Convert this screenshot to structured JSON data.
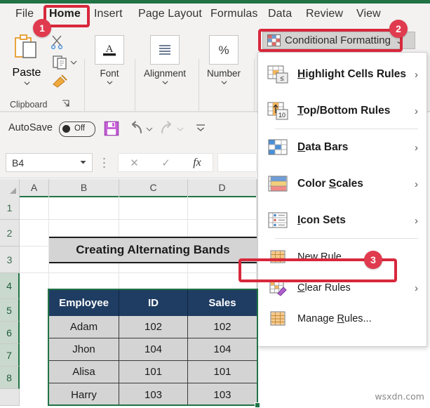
{
  "window": {
    "accent_green": "#217346",
    "annotation_red": "#d8283c"
  },
  "ribbon_tabs": [
    {
      "label": "File",
      "selected": false
    },
    {
      "label": "Home",
      "selected": true
    },
    {
      "label": "Insert",
      "selected": false
    },
    {
      "label": "Page Layout",
      "selected": false
    },
    {
      "label": "Formulas",
      "selected": false
    },
    {
      "label": "Data",
      "selected": false
    },
    {
      "label": "Review",
      "selected": false
    },
    {
      "label": "View",
      "selected": false
    }
  ],
  "ribbon": {
    "clipboard": {
      "paste_label": "Paste",
      "group_label": "Clipboard"
    },
    "groups": [
      {
        "label": "Font",
        "icon": "font-a-icon"
      },
      {
        "label": "Alignment",
        "icon": "alignment-lines-icon"
      },
      {
        "label": "Number",
        "icon": "percent-icon"
      }
    ],
    "conditional_formatting": {
      "label": "Conditional Formatting",
      "dropdown_caret": "⌄"
    }
  },
  "menu": {
    "items": [
      {
        "label": "Highlight Cells Rules",
        "accel": "H",
        "icon": "highlight-cells-icon",
        "submenu": true,
        "arrow": "›"
      },
      {
        "label": "Top/Bottom Rules",
        "accel": "T",
        "icon": "top-bottom-rules-icon",
        "submenu": true,
        "arrow": "›"
      },
      {
        "label": "Data Bars",
        "accel": "D",
        "icon": "data-bars-icon",
        "submenu": true,
        "arrow": "›"
      },
      {
        "label": "Color Scales",
        "accel": "S",
        "icon": "color-scales-icon",
        "submenu": true,
        "arrow": "›"
      },
      {
        "label": "Icon Sets",
        "accel": "I",
        "icon": "icon-sets-icon",
        "submenu": true,
        "arrow": "›"
      },
      {
        "label": "New Rule...",
        "accel": "N",
        "icon": "new-rule-icon",
        "submenu": false,
        "arrow": ""
      },
      {
        "label": "Clear Rules",
        "accel": "C",
        "icon": "clear-rules-icon",
        "submenu": true,
        "arrow": "›"
      },
      {
        "label": "Manage Rules...",
        "accel": "R",
        "icon": "manage-rules-icon",
        "submenu": false,
        "arrow": ""
      }
    ]
  },
  "quick_access": {
    "autosave_label": "AutoSave",
    "autosave_state": "Off",
    "save_icon": "save-disk-icon",
    "undo_icon": "undo-arrow-icon",
    "redo_icon": "redo-arrow-icon",
    "more_icon": "customize-toolbar-icon"
  },
  "formula_bar": {
    "name_box_value": "B4",
    "cancel_icon": "cancel-x-icon",
    "enter_icon": "enter-check-icon",
    "function_icon": "fx-icon",
    "formula_value": ""
  },
  "sheet": {
    "columns": [
      "A",
      "B",
      "C",
      "D"
    ],
    "rows": [
      "1",
      "2",
      "3",
      "4",
      "5",
      "6",
      "7",
      "8"
    ],
    "selected_rows": [
      "4",
      "5",
      "6",
      "7",
      "8"
    ],
    "title_cell": "Creating Alternating Bands",
    "table": {
      "headers": [
        "Employee",
        "ID",
        "Sales"
      ],
      "rows": [
        [
          "Adam",
          "102",
          "102"
        ],
        [
          "Jhon",
          "104",
          "104"
        ],
        [
          "Alisa",
          "101",
          "101"
        ],
        [
          "Harry",
          "103",
          "103"
        ]
      ],
      "header_bg": "#1f3d63",
      "row_bg": "#d4d4d4"
    }
  },
  "annotations": {
    "badges": [
      {
        "number": "1",
        "target": "home-tab"
      },
      {
        "number": "2",
        "target": "conditional-formatting-button"
      },
      {
        "number": "3",
        "target": "new-rule-menu-item"
      }
    ]
  },
  "watermark": "wsxdn.com"
}
